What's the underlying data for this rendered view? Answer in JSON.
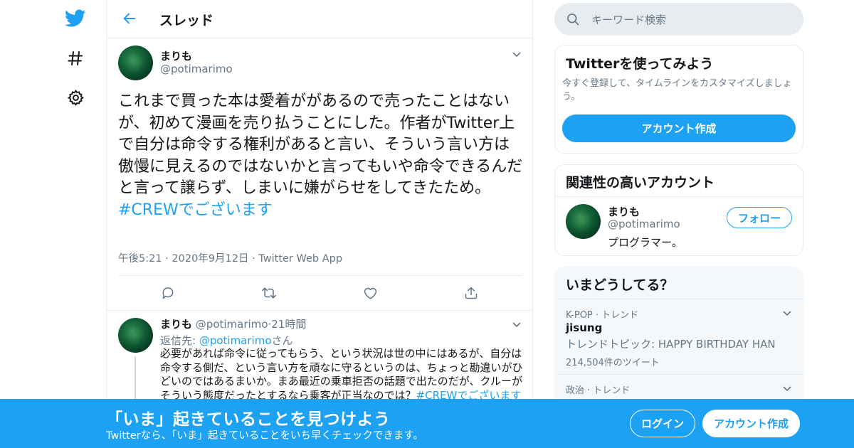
{
  "colors": {
    "accent": "#1da1f2",
    "muted": "#657786",
    "text": "#14171a",
    "border": "#e6ecf0"
  },
  "nav": {
    "icons": [
      "twitter-bird-icon",
      "hashtag-icon",
      "gear-icon"
    ]
  },
  "header": {
    "title": "スレッド"
  },
  "main_tweet": {
    "name": "まりも",
    "handle": "@potimarimo",
    "text": "これまで買った本は愛着ががあるので売ったことはないが、初めて漫画を売り払うことにした。作者がTwitter上で自分は命令する権利があると言い、そういう言い方は傲慢に見えるのではないかと言ってもいや命令できるんだと言って譲らず、しまいに嫌がらせをしてきたため。",
    "hashtag": "#CREWでございます",
    "time": "午後5:21",
    "date": "2020年9月12日",
    "source": "Twitter Web App",
    "sep": "·"
  },
  "reply": {
    "name": "まりも",
    "handle": "@potimarimo",
    "sep": "·",
    "age": "21時間",
    "to_label": "返信先: ",
    "to_handle": "@potimarimo",
    "to_suffix": "さん",
    "text": "必要があれば命令に従ってもらう、という状況は世の中にはあるが、自分は命令する側だ、という言い方を頑なに守るというのは、ちょっと勘違いがひどいのではあるまいか。まあ最近の乗車拒否の話題で出たのだが、クルーがそういう態度だったとするなら乗客が正当なのでは？",
    "hashtag": "#CREWでございます"
  },
  "search": {
    "placeholder": "キーワード検索"
  },
  "signup_card": {
    "title": "Twitterを使ってみよう",
    "desc": "今すぐ登録して、タイムラインをカスタマイズしましょう。",
    "button": "アカウント作成"
  },
  "related_card": {
    "title": "関連性の高いアカウント",
    "name": "まりも",
    "handle": "@potimarimo",
    "bio": "プログラマー。",
    "follow": "フォロー"
  },
  "trends_card": {
    "title": "いまどうしてる？",
    "items": [
      {
        "meta": "K-POP · トレンド",
        "name": "jisung",
        "sub": "トレンドトピック: HAPPY BIRTHDAY HAN",
        "count": "214,504件のツイート"
      },
      {
        "meta": "政治 · トレンド"
      }
    ]
  },
  "banner": {
    "title": "「いま」起きていることを見つけよう",
    "sub": "Twitterなら、「いま」起きていることをいち早くチェックできます。",
    "login": "ログイン",
    "signup": "アカウント作成"
  }
}
